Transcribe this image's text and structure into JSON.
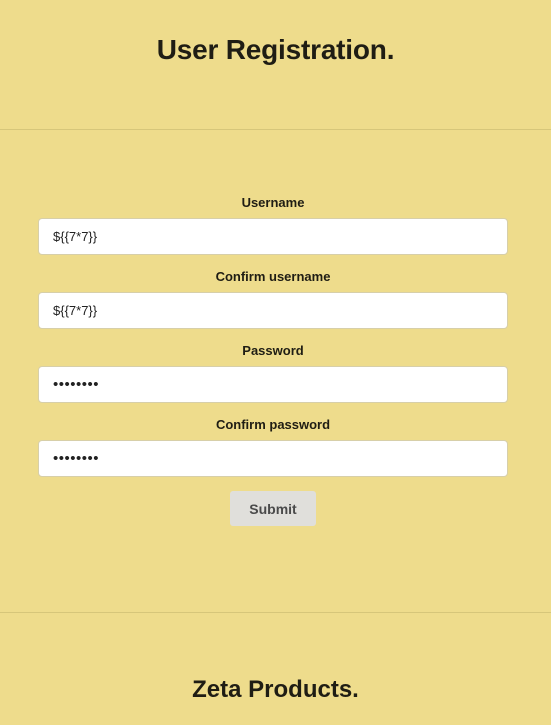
{
  "header": {
    "title": "User Registration."
  },
  "form": {
    "username": {
      "label": "Username",
      "value": "${{7*7}}"
    },
    "confirm_username": {
      "label": "Confirm username",
      "value": "${{7*7}}"
    },
    "password": {
      "label": "Password",
      "value": "12345678"
    },
    "confirm_password": {
      "label": "Confirm password",
      "value": "12345678"
    },
    "submit_label": "Submit"
  },
  "footer": {
    "title": "Zeta Products."
  },
  "colors": {
    "background": "#eedc8c",
    "input_background": "#ffffff",
    "button_background": "#e0dfdb"
  }
}
